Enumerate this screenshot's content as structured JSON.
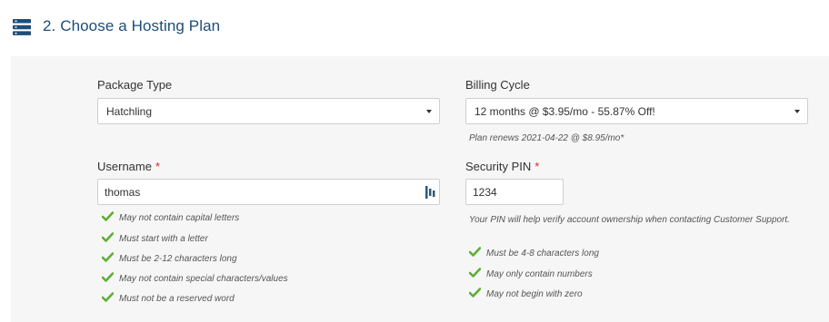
{
  "header": {
    "title": "2. Choose a Hosting Plan",
    "icon": "server-stack-icon",
    "accent_color": "#1d4d78"
  },
  "package_type": {
    "label": "Package Type",
    "selected": "Hatchling"
  },
  "billing_cycle": {
    "label": "Billing Cycle",
    "selected": "12 months @ $3.95/mo - 55.87% Off!",
    "renew_note": "Plan renews 2021-04-22 @ $8.95/mo*"
  },
  "username": {
    "label": "Username",
    "required_mark": "*",
    "value": "thomas",
    "rules": [
      "May not contain capital letters",
      "Must start with a letter",
      "Must be 2-12 characters long",
      "May not contain special characters/values",
      "Must not be a reserved word"
    ]
  },
  "security_pin": {
    "label": "Security PIN",
    "required_mark": "*",
    "value": "1234",
    "help_text": "Your PIN will help verify account ownership when contacting Customer Support.",
    "rules": [
      "Must be 4-8 characters long",
      "May only contain numbers",
      "May not begin with zero"
    ]
  },
  "colors": {
    "check": "#5fae35",
    "required": "#d9262c",
    "panel_bg": "#f6f6f6"
  }
}
